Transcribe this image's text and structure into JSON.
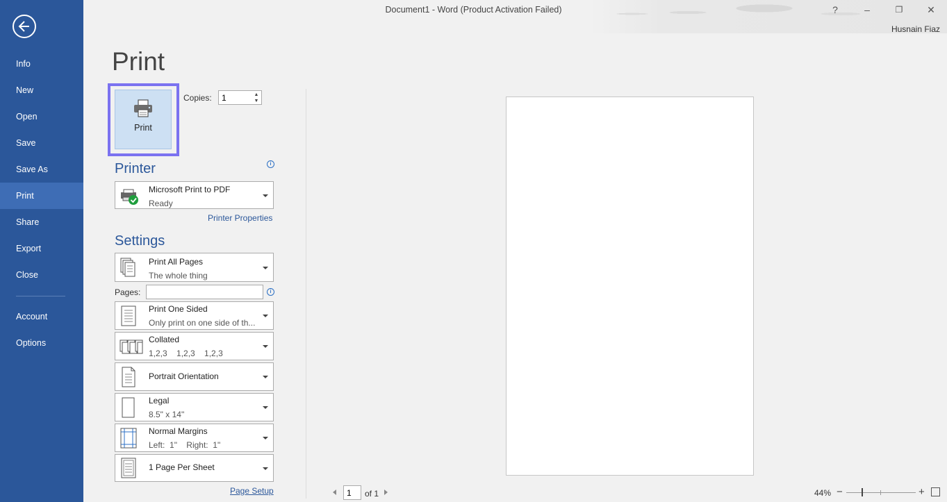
{
  "window": {
    "title": "Document1 - Word (Product Activation Failed)",
    "user": "Husnain Fiaz",
    "help_label": "?",
    "minimize_label": "–",
    "restore_label": "❐",
    "close_label": "✕"
  },
  "sidebar": {
    "items": [
      {
        "label": "Info"
      },
      {
        "label": "New"
      },
      {
        "label": "Open"
      },
      {
        "label": "Save"
      },
      {
        "label": "Save As"
      },
      {
        "label": "Print",
        "active": true
      },
      {
        "label": "Share"
      },
      {
        "label": "Export"
      },
      {
        "label": "Close"
      },
      {
        "label": "Account"
      },
      {
        "label": "Options"
      }
    ]
  },
  "print": {
    "heading": "Print",
    "button_label": "Print",
    "copies_label": "Copies:",
    "copies_value": "1",
    "printer_title": "Printer",
    "printer_name": "Microsoft Print to PDF",
    "printer_status": "Ready",
    "printer_properties": "Printer Properties",
    "settings_title": "Settings",
    "pages_label": "Pages:",
    "pages_value": "",
    "page_setup": "Page Setup",
    "settings": [
      {
        "main": "Print All Pages",
        "sub": "The whole thing"
      },
      {
        "main": "Print One Sided",
        "sub": "Only print on one side of th..."
      },
      {
        "main": "Collated",
        "sub": "1,2,3    1,2,3    1,2,3"
      },
      {
        "main": "Portrait Orientation",
        "sub": ""
      },
      {
        "main": "Legal",
        "sub": "8.5\" x 14\""
      },
      {
        "main": "Normal Margins",
        "sub": "Left:  1\"    Right:  1\""
      },
      {
        "main": "1 Page Per Sheet",
        "sub": ""
      }
    ]
  },
  "preview": {
    "current_page": "1",
    "of_label": "of 1",
    "zoom": "44%",
    "zoom_minus": "−",
    "zoom_plus": "+"
  },
  "colors": {
    "sidebar": "#2b579a",
    "sidebar_active": "#3e6db5",
    "accent_outline": "#7b72f0"
  }
}
